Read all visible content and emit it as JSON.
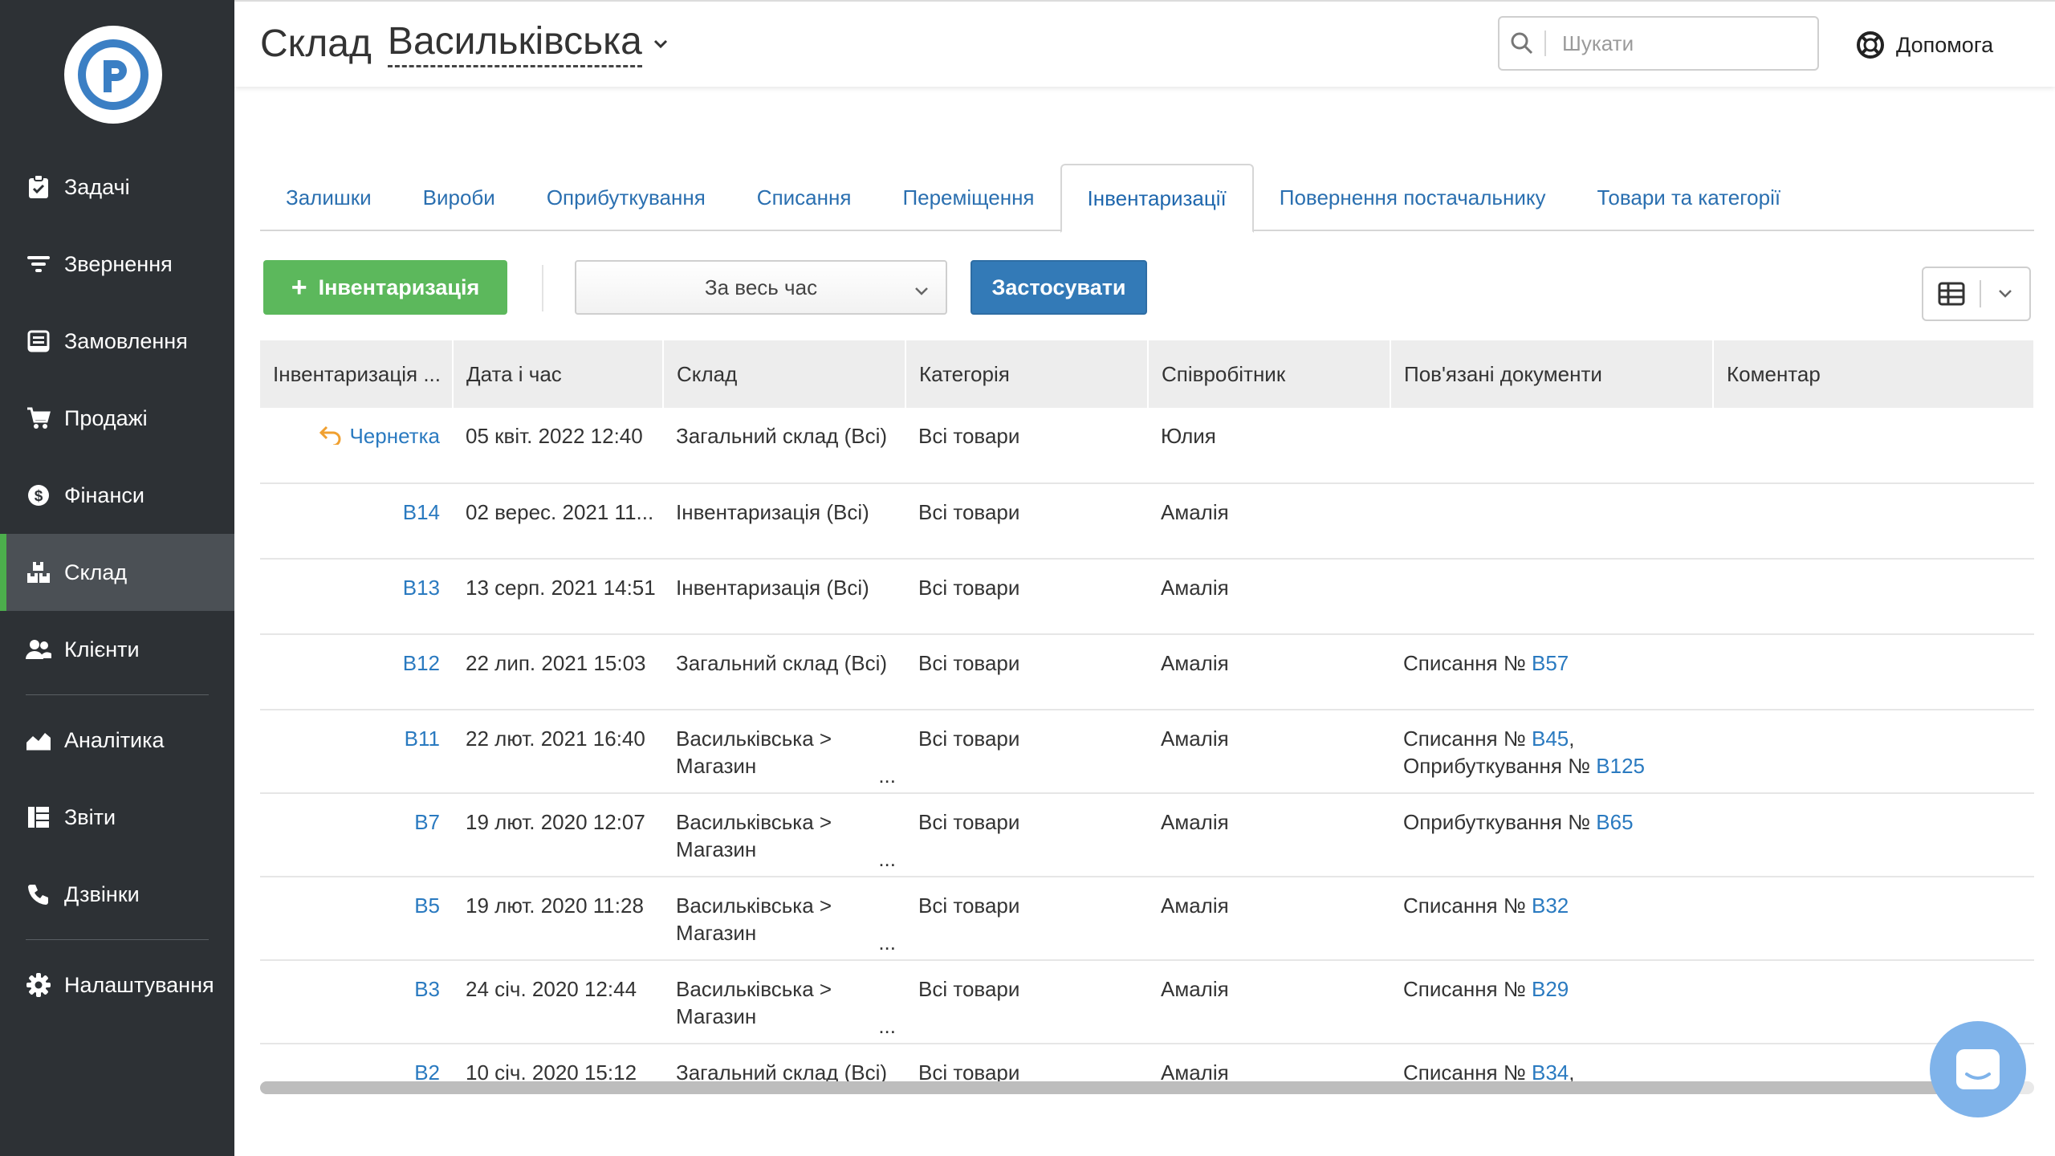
{
  "sidebar": {
    "logo": "P",
    "items": [
      {
        "label": "Задачі",
        "icon": "clipboard-icon"
      },
      {
        "label": "Звернення",
        "icon": "filter-icon"
      },
      {
        "label": "Замовлення",
        "icon": "order-icon"
      },
      {
        "label": "Продажі",
        "icon": "cart-icon"
      },
      {
        "label": "Фінанси",
        "icon": "dollar-icon"
      },
      {
        "label": "Склад",
        "icon": "boxes-icon"
      },
      {
        "label": "Клієнти",
        "icon": "users-icon"
      },
      {
        "label": "Аналітика",
        "icon": "chart-icon"
      },
      {
        "label": "Звіти",
        "icon": "reports-icon"
      },
      {
        "label": "Дзвінки",
        "icon": "phone-icon"
      },
      {
        "label": "Налаштування",
        "icon": "gear-icon"
      }
    ]
  },
  "header": {
    "title_prefix": "Склад",
    "warehouse": "Васильківська",
    "search_placeholder": "Шукати",
    "help_label": "Допомога"
  },
  "tabs": [
    {
      "label": "Залишки"
    },
    {
      "label": "Вироби"
    },
    {
      "label": "Оприбуткування"
    },
    {
      "label": "Списання"
    },
    {
      "label": "Переміщення"
    },
    {
      "label": "Інвентаризації",
      "active": true
    },
    {
      "label": "Повернення постачальнику"
    },
    {
      "label": "Товари та категорії"
    }
  ],
  "toolbar": {
    "add_label": "Інвентаризація",
    "period_value": "За весь час",
    "apply_label": "Застосувати"
  },
  "table": {
    "columns": [
      "Інвентаризація ...",
      "Дата і час",
      "Склад",
      "Категорія",
      "Співробітник",
      "Пов'язані документи",
      "Коментар"
    ],
    "rows": [
      {
        "num": "Чернетка",
        "date": "05 квіт. 2022 12:40",
        "wh1": "Загальний склад (Всі)",
        "wh2": "",
        "cat": "Всі товари",
        "emp": "Юлия",
        "d1p": "",
        "d1n": "",
        "d2p": "",
        "d2n": "",
        "comment": ""
      },
      {
        "num": "В14",
        "date": "02 верес. 2021 11...",
        "wh1": "Інвентаризація (Всі)",
        "wh2": "",
        "cat": "Всі товари",
        "emp": "Амалія",
        "d1p": "",
        "d1n": "",
        "d2p": "",
        "d2n": "",
        "comment": ""
      },
      {
        "num": "В13",
        "date": "13 серп. 2021 14:51",
        "wh1": "Інвентаризація (Всі)",
        "wh2": "",
        "cat": "Всі товари",
        "emp": "Амалія",
        "d1p": "",
        "d1n": "",
        "d2p": "",
        "d2n": "",
        "comment": ""
      },
      {
        "num": "В12",
        "date": "22 лип. 2021 15:03",
        "wh1": "Загальний склад (Всі)",
        "wh2": "",
        "cat": "Всі товари",
        "emp": "Амалія",
        "d1p": "Списання № ",
        "d1n": "В57",
        "d2p": "",
        "d2n": "",
        "comment": ""
      },
      {
        "num": "В11",
        "date": "22 лют. 2021 16:40",
        "wh1": "Васильківська >",
        "wh2": "Магазин",
        "cat": "Всі товари",
        "emp": "Амалія",
        "d1p": "Списання № ",
        "d1n": "В45",
        "d2p": "Оприбуткування № ",
        "d2n": "В125",
        "comment": ""
      },
      {
        "num": "В7",
        "date": "19 лют. 2020 12:07",
        "wh1": "Васильківська >",
        "wh2": "Магазин",
        "cat": "Всі товари",
        "emp": "Амалія",
        "d1p": "Оприбуткування № ",
        "d1n": "В65",
        "d2p": "",
        "d2n": "",
        "comment": ""
      },
      {
        "num": "В5",
        "date": "19 лют. 2020 11:28",
        "wh1": "Васильківська >",
        "wh2": "Магазин",
        "cat": "Всі товари",
        "emp": "Амалія",
        "d1p": "Списання № ",
        "d1n": "В32",
        "d2p": "",
        "d2n": "",
        "comment": ""
      },
      {
        "num": "В3",
        "date": "24 січ. 2020 12:44",
        "wh1": "Васильківська >",
        "wh2": "Магазин",
        "cat": "Всі товари",
        "emp": "Амалія",
        "d1p": "Списання № ",
        "d1n": "В29",
        "d2p": "",
        "d2n": "",
        "comment": ""
      },
      {
        "num": "В2",
        "date": "10 січ. 2020 15:12",
        "wh1": "Загальний склад (Всі)",
        "wh2": "",
        "cat": "Всі товари",
        "emp": "Амалія",
        "d1p": "Списання № ",
        "d1n": "В34",
        "d2p": "",
        "d2n": "",
        "comment": ""
      }
    ]
  },
  "colors": {
    "sidebar_bg": "#2d3135",
    "sidebar_active": "#4b5055",
    "accent_green": "#5cb85c",
    "accent_blue": "#337ab7",
    "link": "#2a7ac0",
    "draft_icon": "#f0a030"
  }
}
